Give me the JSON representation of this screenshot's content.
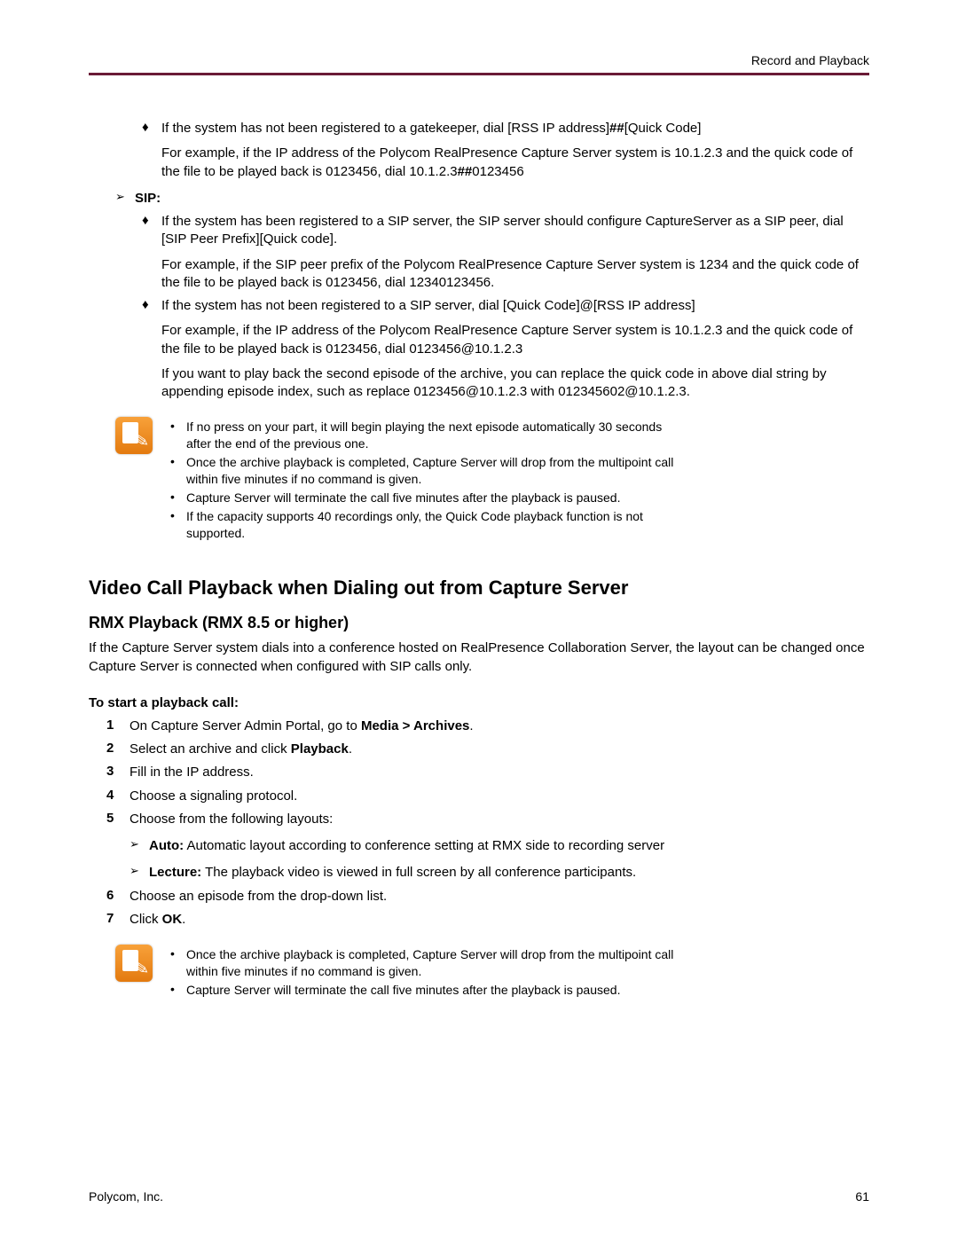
{
  "header": {
    "section": "Record and Playback"
  },
  "footer": {
    "left": "Polycom, Inc.",
    "right": "61"
  },
  "top_diamond": {
    "line1_a": "If the system has not been registered to a gatekeeper, dial [RSS IP address]",
    "line1_b": "##",
    "line1_c": "[Quick Code]",
    "para_a": "For example, if the IP address of the Polycom RealPresence Capture Server system is 10.1.2.3 and the quick code of the file to be played back is 0123456, dial 10.1.2.3",
    "para_b": "##",
    "para_c": "0123456"
  },
  "sip": {
    "label": "SIP:",
    "d1_line": "If the system has been registered to a SIP server, the SIP server should configure CaptureServer as a SIP peer, dial [SIP Peer Prefix][Quick code].",
    "d1_para": "For example, if the SIP peer prefix of the Polycom RealPresence Capture Server system is 1234 and the quick code of the file to be played back is 0123456, dial 12340123456.",
    "d2_line": "If the system has not been registered to a SIP server, dial [Quick Code]@[RSS IP address]",
    "d2_para1": "For example, if the IP address of the Polycom RealPresence Capture Server system is 10.1.2.3 and the quick code of the file to be played back is 0123456, dial 0123456@10.1.2.3",
    "d2_para2": "If you want to play back the second episode of the archive, you can replace the quick code in above dial string by appending episode index, such as replace 0123456@10.1.2.3 with 012345602@10.1.2.3."
  },
  "note1": [
    "If no press on your part, it will begin playing the next episode automatically 30 seconds after the end of the previous one.",
    "Once the archive playback is completed, Capture Server will drop from the multipoint call within five minutes if no command is given.",
    "Capture Server will terminate the call five minutes after the playback is paused.",
    "If the capacity supports 40 recordings only, the Quick Code playback function is not supported."
  ],
  "h2": "Video Call Playback when Dialing out from Capture Server",
  "h3": "RMX Playback (RMX 8.5 or higher)",
  "intro": "If the Capture Server system dials into a conference hosted on RealPresence Collaboration Server, the layout can be changed once Capture Server is connected when configured with SIP calls only.",
  "h4": "To start a playback call:",
  "steps": {
    "s1a": "On Capture Server Admin Portal, go to ",
    "s1b": "Media > Archives",
    "s1c": ".",
    "s2a": "Select an archive and click ",
    "s2b": "Playback",
    "s2c": ".",
    "s3": "Fill in the IP address.",
    "s4": "Choose a signaling protocol.",
    "s5": "Choose from the following layouts:",
    "layout_auto_label": "Auto:",
    "layout_auto_text": " Automatic layout according to conference setting at RMX side to recording server",
    "layout_lecture_label": "Lecture:",
    "layout_lecture_text": " The playback video is viewed in full screen by all conference participants.",
    "s6": "Choose an episode from the drop-down list.",
    "s7a": "Click ",
    "s7b": "OK",
    "s7c": "."
  },
  "note2": [
    "Once the archive playback is completed, Capture Server will drop from the multipoint call within five minutes if no command is given.",
    "Capture Server will terminate the call five minutes after the playback is paused."
  ]
}
